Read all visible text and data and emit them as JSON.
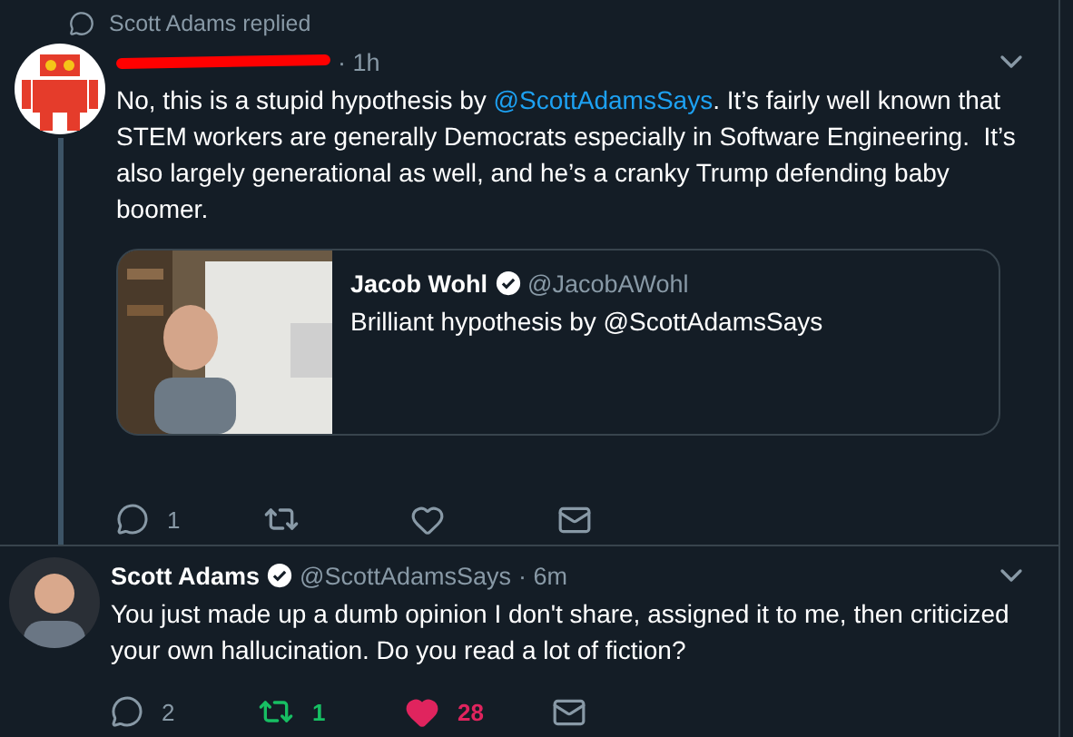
{
  "context": {
    "text": "Scott Adams replied"
  },
  "tweets": [
    {
      "redacted": true,
      "verified": false,
      "time": "· 1h",
      "avatar": {
        "kind": "robot"
      },
      "thread_line": true,
      "body": [
        {
          "kind": "plain",
          "text": "No, this is a stupid hypothesis by "
        },
        {
          "kind": "mention",
          "text": "@ScottAdamsSays"
        },
        {
          "kind": "plain",
          "text": ". It’s fairly well known that STEM workers are generally Democrats especially in Software Engineering.  It’s also largely generational as well, and he’s a cranky Trump defending baby boomer."
        }
      ],
      "quote": {
        "name": "Jacob Wohl",
        "verified": true,
        "handle": "@JacobAWohl",
        "text": "Brilliant hypothesis by @ScottAdamsSays"
      },
      "actions": {
        "replies": "1",
        "retweeted": false,
        "liked": false
      }
    },
    {
      "name": "Scott Adams",
      "handle": "@ScottAdamsSays",
      "redacted": false,
      "verified": true,
      "time": "· 6m",
      "avatar": {
        "kind": "person"
      },
      "thread_line": false,
      "body": [
        {
          "kind": "plain",
          "text": "You just made up a dumb opinion I don't share, assigned it to me, then criticized your own hallucination. Do you read a lot of fiction?"
        }
      ],
      "actions": {
        "replies": "2",
        "retweets": "1",
        "likes": "28",
        "retweeted": true,
        "liked": true
      }
    }
  ]
}
